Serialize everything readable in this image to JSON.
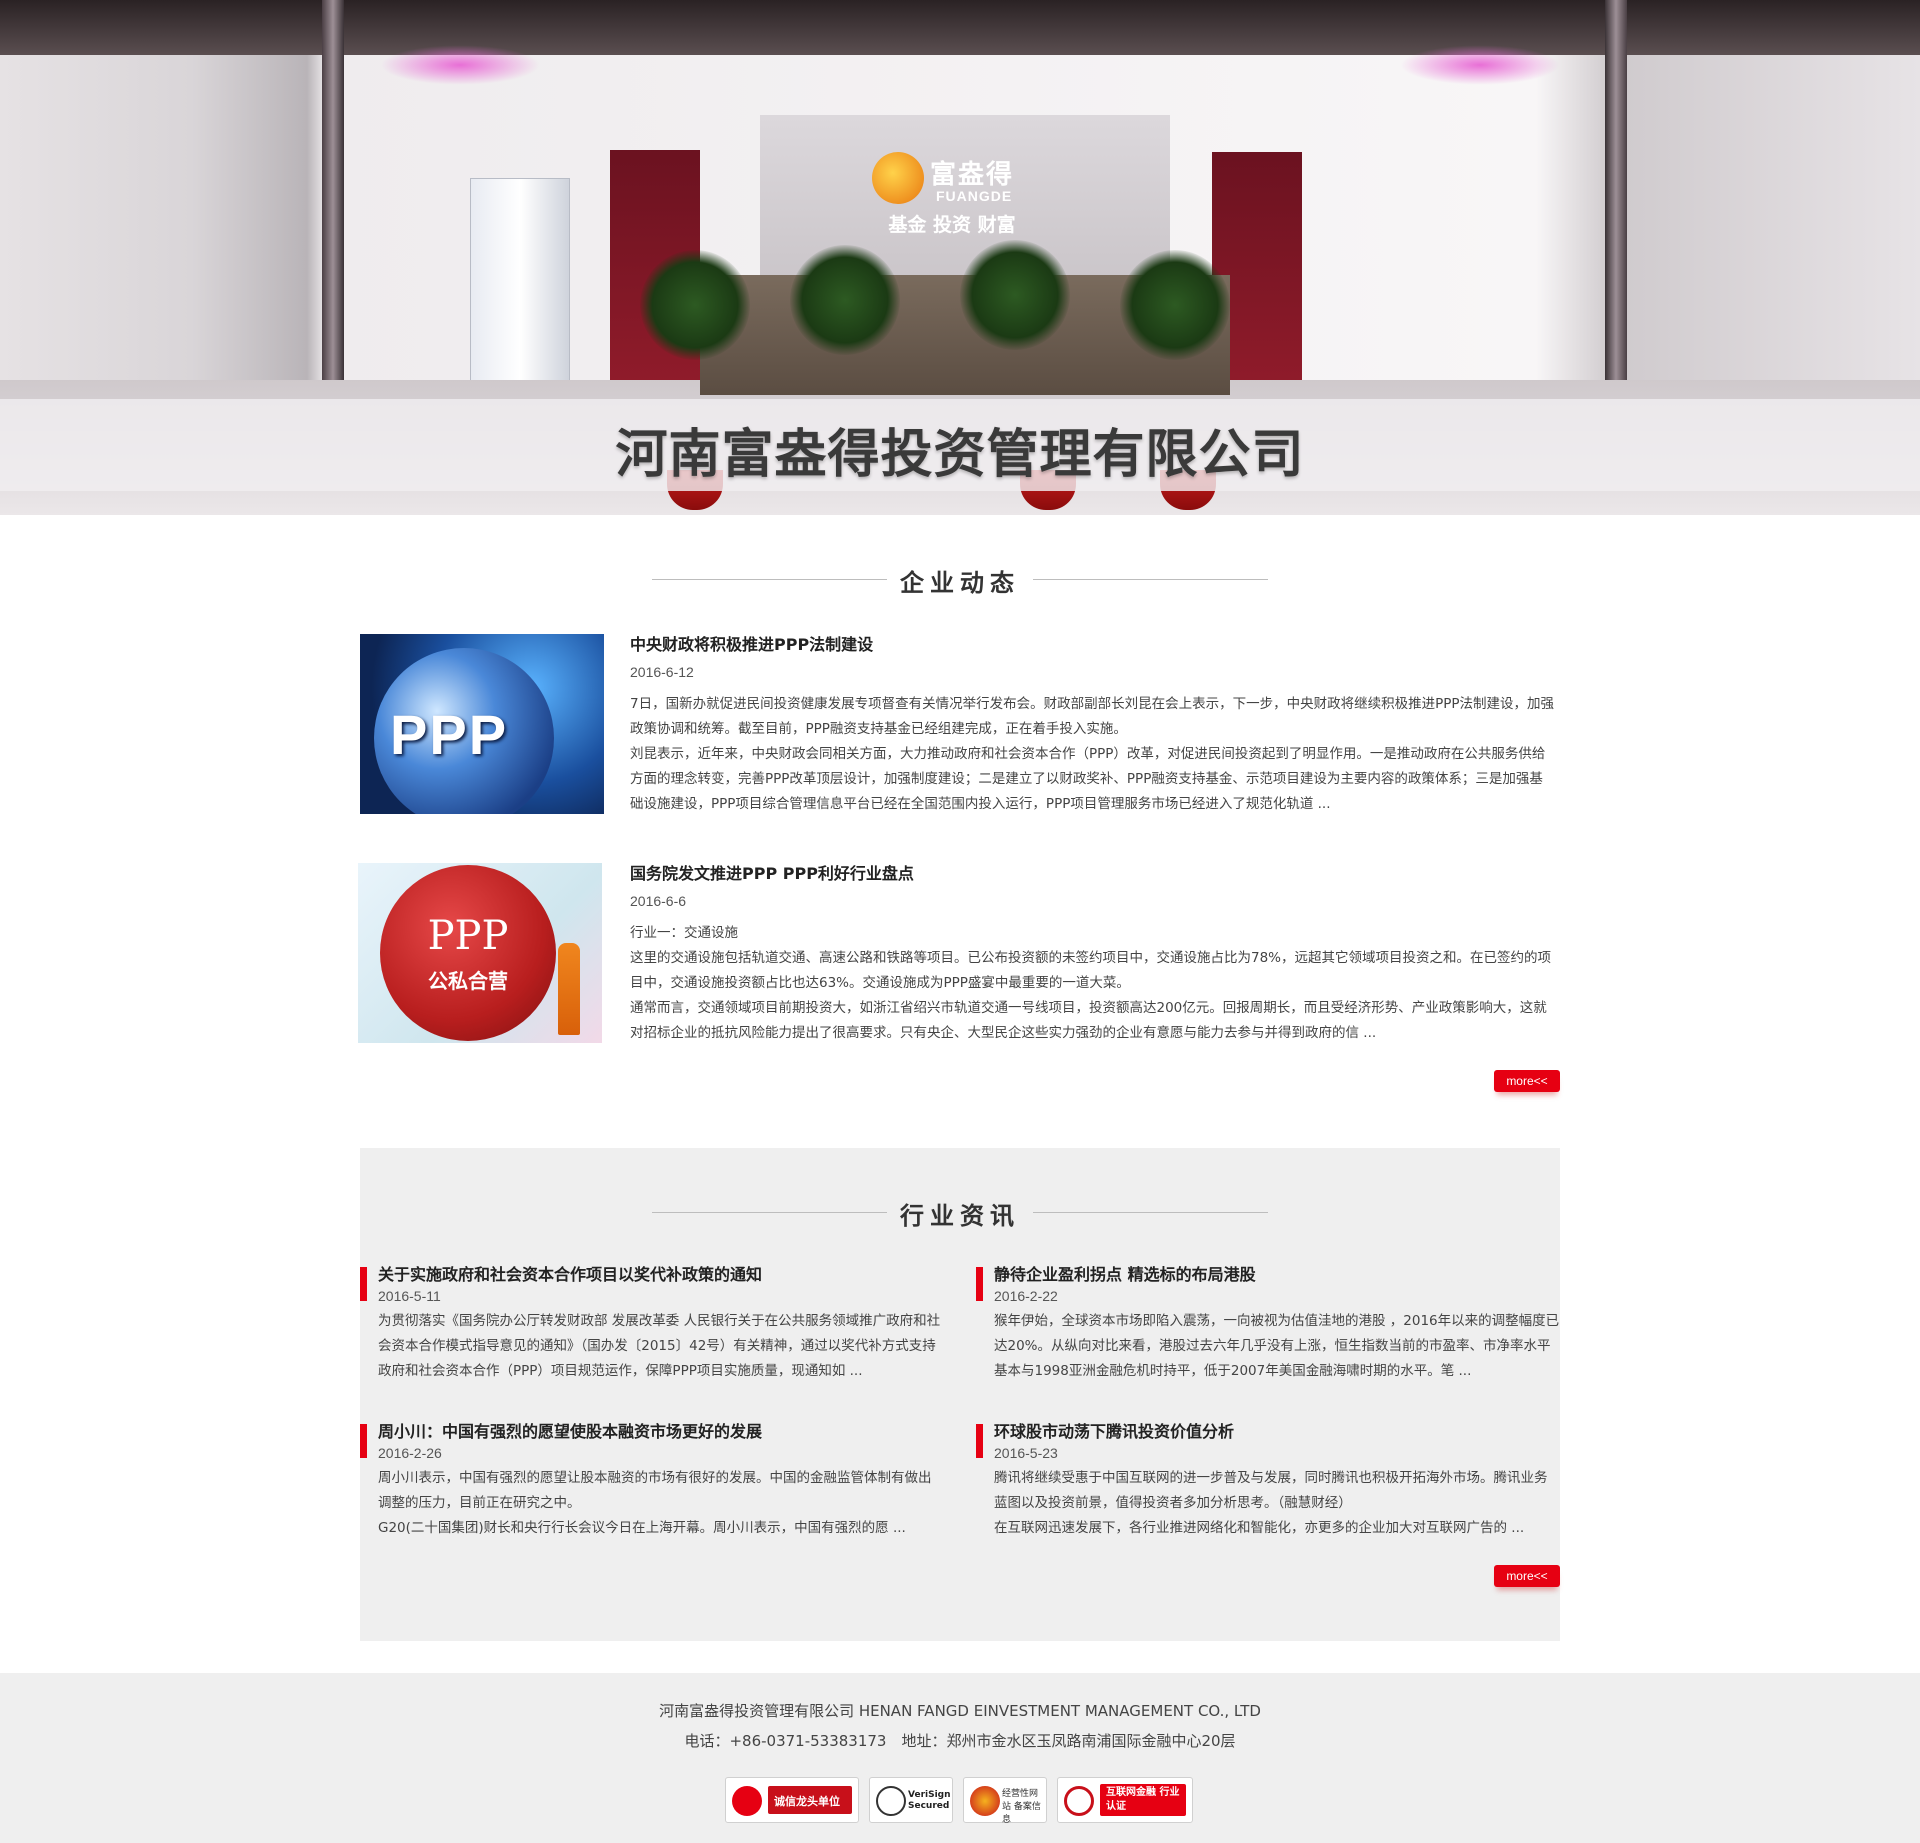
{
  "hero": {
    "title": "河南富盎得投资管理有限公司",
    "logo_cn": "富盎得",
    "logo_en": "FUANGDE",
    "logo_sub": "基金 投资 财富"
  },
  "news_section": {
    "heading": "企业动态",
    "items": [
      {
        "title": "中央财政将积极推进PPP法制建设",
        "date": "2016-6-12",
        "thumb_label": "PPP",
        "text": "7日，国新办就促进民间投资健康发展专项督查有关情况举行发布会。财政部副部长刘昆在会上表示，下一步，中央财政将继续积极推进PPP法制建设，加强政策协调和统筹。截至目前，PPP融资支持基金已经组建完成，正在着手投入实施。\n刘昆表示，近年来，中央财政会同相关方面，大力推动政府和社会资本合作（PPP）改革，对促进民间投资起到了明显作用。一是推动政府在公共服务供给方面的理念转变，完善PPP改革顶层设计，加强制度建设；二是建立了以财政奖补、PPP融资支持基金、示范项目建设为主要内容的政策体系；三是加强基础设施建设，PPP项目综合管理信息平台已经在全国范围内投入运行，PPP项目管理服务市场已经进入了规范化轨道 ..."
      },
      {
        "title": "国务院发文推进PPP PPP利好行业盘点",
        "date": "2016-6-6",
        "thumb_label": "PPP",
        "thumb_sub": "公私合营",
        "text": "行业一：交通设施\n这里的交通设施包括轨道交通、高速公路和铁路等项目。已公布投资额的未签约项目中，交通设施占比为78%，远超其它领域项目投资之和。在已签约的项目中，交通设施投资额占比也达63%。交通设施成为PPP盛宴中最重要的一道大菜。\n通常而言，交通领域项目前期投资大，如浙江省绍兴市轨道交通一号线项目，投资额高达200亿元。回报周期长，而且受经济形势、产业政策影响大，这就对招标企业的抵抗风险能力提出了很高要求。只有央企、大型民企这些实力强劲的企业有意愿与能力去参与并得到政府的信 ..."
      }
    ],
    "more_label": "more<<"
  },
  "industry_section": {
    "heading": "行业资讯",
    "items": [
      {
        "title": "关于实施政府和社会资本合作项目以奖代补政策的通知",
        "date": "2016-5-11",
        "text": "为贯彻落实《国务院办公厅转发财政部 发展改革委 人民银行关于在公共服务领域推广政府和社会资本合作模式指导意见的通知》（国办发〔2015〕42号）有关精神，通过以奖代补方式支持政府和社会资本合作（PPP）项目规范运作，保障PPP项目实施质量，现通知如 ..."
      },
      {
        "title": "静待企业盈利拐点 精选标的布局港股",
        "date": "2016-2-22",
        "text": "猴年伊始，全球资本市场即陷入震荡，一向被视为估值洼地的港股 ，2016年以来的调整幅度已达20%。从纵向对比来看，港股过去六年几乎没有上涨，恒生指数当前的市盈率、市净率水平基本与1998亚洲金融危机时持平，低于2007年美国金融海啸时期的水平。笔 ..."
      },
      {
        "title": "周小川：中国有强烈的愿望使股本融资市场更好的发展",
        "date": "2016-2-26",
        "text": "周小川表示，中国有强烈的愿望让股本融资的市场有很好的发展。中国的金融监管体制有做出调整的压力，目前正在研究之中。\nG20(二十国集团)财长和央行行长会议今日在上海开幕。周小川表示，中国有强烈的愿 ..."
      },
      {
        "title": "环球股市动荡下腾讯投资价值分析",
        "date": "2016-5-23",
        "text": "腾讯将继续受惠于中国互联网的进一步普及与发展，同时腾讯也积极开拓海外市场。腾讯业务蓝图以及投资前景，值得投资者多加分析思考。（融慧财经）\n在互联网迅速发展下，各行业推进网络化和智能化，亦更多的企业加大对互联网广告的 ..."
      }
    ],
    "more_label": "more<<"
  },
  "footer": {
    "company": "河南富盎得投资管理有限公司 HENAN FANGD EINVESTMENT MANAGEMENT CO., LTD",
    "contact": "电话：+86-0371-53383173　地址：郑州市金水区玉凤路南浦国际金融中心20层",
    "badges": [
      {
        "label": "诚信龙头单位",
        "icon": "credit-icon"
      },
      {
        "label": "VeriSign Secured",
        "icon": "verisign-icon"
      },
      {
        "label": "经营性网站 备案信息",
        "icon": "police-badge-icon"
      },
      {
        "label": "互联网金融 行业认证",
        "icon": "certification-icon"
      }
    ]
  },
  "colors": {
    "accent": "#e60012",
    "section_bg": "#efefef",
    "footer_bg": "#efefef"
  }
}
